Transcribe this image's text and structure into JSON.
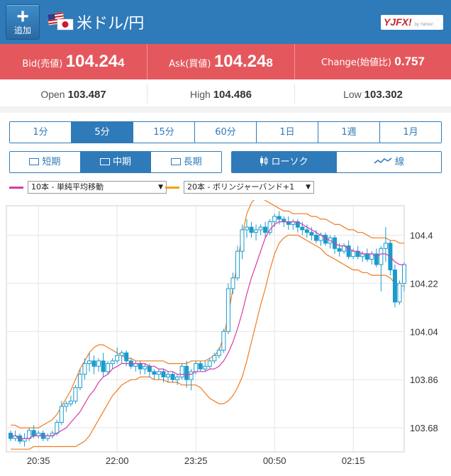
{
  "header": {
    "add_label": "追加",
    "pair": "米ドル/円",
    "logo": "YJFX!",
    "logo_sub": "by Yahoo!"
  },
  "prices": {
    "bid_label": "Bid(売値)",
    "bid_main": "104.24",
    "bid_pip": "4",
    "ask_label": "Ask(買値)",
    "ask_main": "104.24",
    "ask_pip": "8",
    "change_label": "Change(始値比)",
    "change_value": "0.757"
  },
  "ohl": {
    "open_label": "Open",
    "open_value": "103.487",
    "high_label": "High",
    "high_value": "104.486",
    "low_label": "Low",
    "low_value": "103.302"
  },
  "intervals": [
    "1分",
    "5分",
    "15分",
    "60分",
    "1日",
    "1週",
    "1月"
  ],
  "active_interval": 1,
  "terms": [
    "短期",
    "中期",
    "長期"
  ],
  "active_term": 1,
  "chart_styles": [
    "ローソク",
    "線"
  ],
  "active_style": 0,
  "indicators": {
    "ma": {
      "value": "10本 - 単純平均移動",
      "color": "#d83aa6"
    },
    "bb": {
      "value": "20本 - ボリンジャーバンド+1",
      "color": "#f2a20b"
    }
  },
  "colors": {
    "header": "#2f7ab9",
    "price_bar": "#e4585d",
    "candle": "#1a9bcc",
    "bb_line": "#f07b1f",
    "ma_line": "#d83aa6"
  },
  "chart_data": {
    "type": "candlestick",
    "y_ticks": [
      "104.4",
      "104.22",
      "104.04",
      "103.86",
      "103.68"
    ],
    "y_tick_values": [
      104.4,
      104.22,
      104.04,
      103.86,
      103.68
    ],
    "ylim": [
      103.59,
      104.51
    ],
    "x_ticks": [
      "20:35",
      "22:00",
      "23:25",
      "00:50",
      "02:15"
    ],
    "x_tick_index": [
      6,
      23,
      40,
      57,
      74
    ],
    "grid": true,
    "ohlc": [
      [
        103.66,
        103.67,
        103.63,
        103.64
      ],
      [
        103.64,
        103.67,
        103.63,
        103.65
      ],
      [
        103.65,
        103.66,
        103.62,
        103.63
      ],
      [
        103.63,
        103.66,
        103.61,
        103.64
      ],
      [
        103.64,
        103.68,
        103.63,
        103.67
      ],
      [
        103.67,
        103.69,
        103.64,
        103.65
      ],
      [
        103.65,
        103.67,
        103.64,
        103.66
      ],
      [
        103.66,
        103.67,
        103.63,
        103.64
      ],
      [
        103.64,
        103.66,
        103.63,
        103.65
      ],
      [
        103.65,
        103.67,
        103.64,
        103.66
      ],
      [
        103.66,
        103.71,
        103.65,
        103.7
      ],
      [
        103.7,
        103.78,
        103.69,
        103.76
      ],
      [
        103.76,
        103.78,
        103.74,
        103.77
      ],
      [
        103.77,
        103.8,
        103.76,
        103.78
      ],
      [
        103.78,
        103.84,
        103.77,
        103.83
      ],
      [
        103.83,
        103.9,
        103.82,
        103.88
      ],
      [
        103.88,
        103.94,
        103.86,
        103.92
      ],
      [
        103.92,
        103.96,
        103.89,
        103.93
      ],
      [
        103.93,
        103.95,
        103.88,
        103.91
      ],
      [
        103.91,
        103.94,
        103.89,
        103.93
      ],
      [
        103.93,
        103.96,
        103.87,
        103.89
      ],
      [
        103.89,
        103.93,
        103.88,
        103.92
      ],
      [
        103.92,
        103.94,
        103.9,
        103.93
      ],
      [
        103.93,
        103.98,
        103.92,
        103.95
      ],
      [
        103.95,
        103.97,
        103.92,
        103.96
      ],
      [
        103.96,
        103.97,
        103.91,
        103.93
      ],
      [
        103.93,
        103.94,
        103.9,
        103.91
      ],
      [
        103.91,
        103.93,
        103.89,
        103.92
      ],
      [
        103.92,
        103.93,
        103.88,
        103.9
      ],
      [
        103.9,
        103.92,
        103.88,
        103.91
      ],
      [
        103.91,
        103.92,
        103.87,
        103.89
      ],
      [
        103.89,
        103.9,
        103.86,
        103.88
      ],
      [
        103.88,
        103.9,
        103.86,
        103.89
      ],
      [
        103.89,
        103.9,
        103.85,
        103.87
      ],
      [
        103.87,
        103.89,
        103.85,
        103.88
      ],
      [
        103.88,
        103.89,
        103.85,
        103.86
      ],
      [
        103.86,
        103.88,
        103.84,
        103.87
      ],
      [
        103.87,
        103.92,
        103.86,
        103.91
      ],
      [
        103.91,
        103.93,
        103.83,
        103.86
      ],
      [
        103.86,
        103.9,
        103.82,
        103.89
      ],
      [
        103.89,
        103.93,
        103.88,
        103.92
      ],
      [
        103.92,
        103.93,
        103.89,
        103.9
      ],
      [
        103.9,
        103.93,
        103.89,
        103.91
      ],
      [
        103.91,
        103.94,
        103.9,
        103.93
      ],
      [
        103.93,
        103.96,
        103.92,
        103.95
      ],
      [
        103.95,
        103.98,
        103.94,
        103.97
      ],
      [
        103.97,
        104.05,
        103.96,
        104.04
      ],
      [
        104.04,
        104.22,
        104.03,
        104.2
      ],
      [
        104.2,
        104.26,
        104.18,
        104.24
      ],
      [
        104.24,
        104.36,
        104.23,
        104.34
      ],
      [
        104.34,
        104.44,
        104.31,
        104.42
      ],
      [
        104.42,
        104.46,
        104.39,
        104.43
      ],
      [
        104.43,
        104.45,
        104.39,
        104.41
      ],
      [
        104.41,
        104.44,
        104.38,
        104.42
      ],
      [
        104.42,
        104.44,
        104.4,
        104.43
      ],
      [
        104.43,
        104.45,
        104.39,
        104.41
      ],
      [
        104.41,
        104.46,
        104.4,
        104.45
      ],
      [
        104.45,
        104.48,
        104.43,
        104.47
      ],
      [
        104.47,
        104.49,
        104.44,
        104.46
      ],
      [
        104.46,
        104.47,
        104.43,
        104.45
      ],
      [
        104.45,
        104.47,
        104.42,
        104.44
      ],
      [
        104.44,
        104.46,
        104.42,
        104.45
      ],
      [
        104.45,
        104.46,
        104.41,
        104.43
      ],
      [
        104.43,
        104.45,
        104.4,
        104.42
      ],
      [
        104.42,
        104.44,
        104.39,
        104.41
      ],
      [
        104.41,
        104.43,
        104.38,
        104.4
      ],
      [
        104.4,
        104.42,
        104.37,
        104.38
      ],
      [
        104.38,
        104.41,
        104.36,
        104.4
      ],
      [
        104.4,
        104.41,
        104.36,
        104.37
      ],
      [
        104.37,
        104.4,
        104.35,
        104.39
      ],
      [
        104.39,
        104.4,
        104.33,
        104.35
      ],
      [
        104.35,
        104.37,
        104.32,
        104.34
      ],
      [
        104.34,
        104.37,
        104.33,
        104.36
      ],
      [
        104.36,
        104.38,
        104.31,
        104.32
      ],
      [
        104.32,
        104.35,
        104.31,
        104.34
      ],
      [
        104.34,
        104.36,
        104.31,
        104.32
      ],
      [
        104.32,
        104.34,
        104.3,
        104.33
      ],
      [
        104.33,
        104.35,
        104.3,
        104.31
      ],
      [
        104.31,
        104.34,
        104.29,
        104.33
      ],
      [
        104.33,
        104.35,
        104.28,
        104.29
      ],
      [
        104.29,
        104.36,
        104.19,
        104.35
      ],
      [
        104.35,
        104.43,
        104.3,
        104.37
      ],
      [
        104.37,
        104.38,
        104.25,
        104.27
      ],
      [
        104.27,
        104.29,
        104.13,
        104.15
      ],
      [
        104.15,
        104.23,
        104.14,
        104.22
      ],
      [
        104.22,
        104.3,
        104.19,
        104.29
      ]
    ],
    "ma": [
      103.65,
      103.65,
      103.64,
      103.64,
      103.64,
      103.65,
      103.65,
      103.65,
      103.65,
      103.65,
      103.66,
      103.67,
      103.68,
      103.7,
      103.72,
      103.74,
      103.77,
      103.8,
      103.82,
      103.85,
      103.87,
      103.88,
      103.9,
      103.91,
      103.92,
      103.92,
      103.92,
      103.92,
      103.92,
      103.92,
      103.91,
      103.91,
      103.9,
      103.9,
      103.89,
      103.89,
      103.88,
      103.88,
      103.88,
      103.88,
      103.89,
      103.89,
      103.89,
      103.9,
      103.9,
      103.91,
      103.93,
      103.96,
      104.0,
      104.05,
      104.11,
      104.18,
      104.24,
      104.29,
      104.34,
      104.39,
      104.42,
      104.44,
      104.45,
      104.45,
      104.45,
      104.45,
      104.45,
      104.44,
      104.43,
      104.42,
      104.41,
      104.4,
      104.39,
      104.38,
      104.37,
      104.36,
      104.36,
      104.35,
      104.34,
      104.34,
      104.33,
      104.33,
      104.33,
      104.32,
      104.33,
      104.33,
      104.32,
      104.3,
      104.29,
      104.29
    ],
    "bb_upper": [
      103.69,
      103.69,
      103.68,
      103.68,
      103.68,
      103.68,
      103.68,
      103.69,
      103.7,
      103.71,
      103.73,
      103.76,
      103.79,
      103.82,
      103.86,
      103.9,
      103.93,
      103.96,
      103.98,
      103.99,
      103.99,
      103.98,
      103.97,
      103.96,
      103.95,
      103.94,
      103.94,
      103.93,
      103.93,
      103.93,
      103.93,
      103.93,
      103.93,
      103.93,
      103.92,
      103.92,
      103.92,
      103.92,
      103.92,
      103.93,
      103.93,
      103.93,
      103.93,
      103.94,
      103.95,
      103.97,
      104.02,
      104.1,
      104.2,
      104.3,
      104.4,
      104.48,
      104.52,
      104.54,
      104.54,
      104.53,
      104.52,
      104.51,
      104.5,
      104.49,
      104.49,
      104.48,
      104.48,
      104.48,
      104.48,
      104.47,
      104.47,
      104.46,
      104.46,
      104.45,
      104.44,
      104.44,
      104.43,
      104.42,
      104.42,
      104.41,
      104.41,
      104.4,
      104.39,
      104.39,
      104.39,
      104.39,
      104.38,
      104.38,
      104.37,
      104.37
    ],
    "bb_lower": [
      103.6,
      103.6,
      103.6,
      103.6,
      103.6,
      103.61,
      103.61,
      103.61,
      103.61,
      103.61,
      103.61,
      103.61,
      103.61,
      103.61,
      103.61,
      103.62,
      103.63,
      103.65,
      103.68,
      103.71,
      103.74,
      103.77,
      103.8,
      103.82,
      103.84,
      103.85,
      103.86,
      103.86,
      103.87,
      103.87,
      103.87,
      103.86,
      103.86,
      103.86,
      103.85,
      103.85,
      103.85,
      103.84,
      103.84,
      103.84,
      103.84,
      103.83,
      103.81,
      103.79,
      103.78,
      103.77,
      103.77,
      103.78,
      103.8,
      103.83,
      103.87,
      103.93,
      104.0,
      104.07,
      104.14,
      104.2,
      104.27,
      104.33,
      104.37,
      104.39,
      104.4,
      104.4,
      104.4,
      104.39,
      104.38,
      104.37,
      104.36,
      104.35,
      104.33,
      104.32,
      104.31,
      104.3,
      104.29,
      104.28,
      104.27,
      104.27,
      104.26,
      104.26,
      104.25,
      104.25,
      104.25,
      104.25,
      104.24,
      104.22,
      104.21,
      104.21
    ]
  }
}
